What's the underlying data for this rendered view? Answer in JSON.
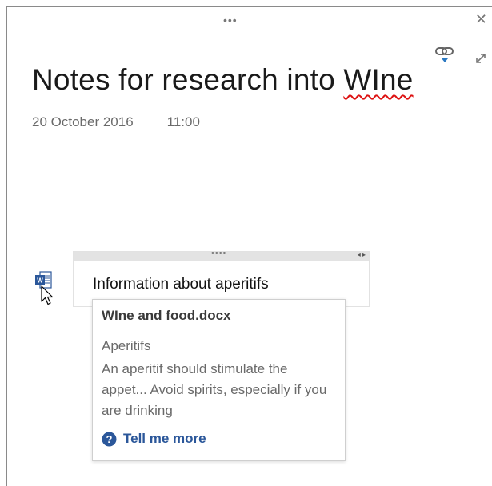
{
  "window": {
    "drag_handle": "•••",
    "close_glyph": "✕"
  },
  "note": {
    "title_prefix": "Notes for research into ",
    "title_misspelled": "WIne",
    "date": "20 October 2016",
    "time": "11:00"
  },
  "embed": {
    "text": "Information about aperitifs",
    "handle": "••••",
    "arrows": "◂ ▸",
    "icon_letter": "W"
  },
  "popup": {
    "file_name": "WIne and food.docx",
    "heading": "Aperitifs",
    "snippet": "An aperitif should stimulate the appet...  Avoid spirits, especially if you are drinking",
    "link_label": "Tell me more"
  },
  "colors": {
    "accent": "#2b579a",
    "spellcheck": "#dd1111"
  }
}
